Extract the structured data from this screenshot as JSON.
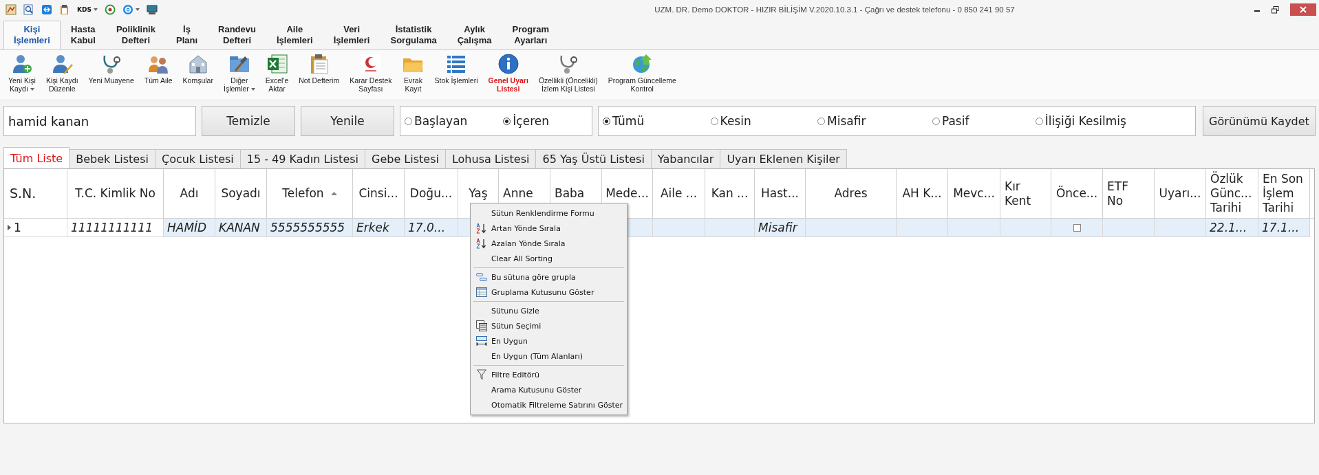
{
  "window": {
    "title": "UZM. DR. Demo DOKTOR - HIZIR BİLİŞİM V.2020.10.3.1 - Çağrı ve destek telefonu - 0 850 241 90 57"
  },
  "quick_access": [
    {
      "kind": "icon"
    },
    {
      "kind": "icon"
    },
    {
      "kind": "icon"
    },
    {
      "kind": "icon"
    },
    {
      "kind": "text",
      "label": "KDS",
      "dropdown": true
    },
    {
      "kind": "icon"
    },
    {
      "kind": "icon",
      "dropdown": true
    },
    {
      "kind": "icon"
    }
  ],
  "ribbon_tabs": [
    {
      "label": "Kişi\nİşlemleri",
      "selected": true
    },
    {
      "label": "Hasta\nKabul",
      "selected": false
    },
    {
      "label": "Poliklinik\nDefteri",
      "selected": false
    },
    {
      "label": "İş\nPlanı",
      "selected": false
    },
    {
      "label": "Randevu\nDefteri",
      "selected": false
    },
    {
      "label": "Aile\nİşlemleri",
      "selected": false
    },
    {
      "label": "Veri\nİşlemleri",
      "selected": false
    },
    {
      "label": "İstatistik\nSorgulama",
      "selected": false
    },
    {
      "label": "Aylık\nÇalışma",
      "selected": false
    },
    {
      "label": "Program\nAyarları",
      "selected": false
    }
  ],
  "toolbar": [
    {
      "label": "Yeni Kişi\nKaydı",
      "dropdown": true,
      "highlighted": false
    },
    {
      "label": "Kişi Kaydı\nDüzenle",
      "dropdown": false,
      "highlighted": false
    },
    {
      "label": "Yeni Muayene",
      "dropdown": false,
      "highlighted": false
    },
    {
      "label": "Tüm Aile",
      "dropdown": false,
      "highlighted": false
    },
    {
      "label": "Komşular",
      "dropdown": false,
      "highlighted": false
    },
    {
      "label": "Diğer\nİşlemler",
      "dropdown": true,
      "highlighted": false
    },
    {
      "label": "Excel'e\nAktar",
      "dropdown": false,
      "highlighted": false
    },
    {
      "label": "Not Defterim",
      "dropdown": false,
      "highlighted": false
    },
    {
      "label": "Karar Destek\nSayfası",
      "dropdown": false,
      "highlighted": false
    },
    {
      "label": "Evrak\nKayıt",
      "dropdown": false,
      "highlighted": false
    },
    {
      "label": "Stok İşlemleri",
      "dropdown": false,
      "highlighted": false
    },
    {
      "label": "Genel Uyarı\nListesi",
      "dropdown": false,
      "highlighted": true
    },
    {
      "label": "Özellikli (Öncelikli)\nİzlem Kişi Listesi",
      "dropdown": false,
      "highlighted": false
    },
    {
      "label": "Program Güncelleme\nKontrol",
      "dropdown": false,
      "highlighted": false
    }
  ],
  "search": {
    "value": "hamid kanan"
  },
  "buttons": [
    "Temizle",
    "Yenile"
  ],
  "match_options": [
    {
      "label": "Başlayan",
      "selected": false
    },
    {
      "label": "İçeren",
      "selected": true
    }
  ],
  "status_options": [
    {
      "label": "Tümü",
      "selected": true
    },
    {
      "label": "Kesin",
      "selected": false
    },
    {
      "label": "Misafir",
      "selected": false
    },
    {
      "label": "Pasif",
      "selected": false
    },
    {
      "label": "İlişiği Kesilmiş",
      "selected": false
    }
  ],
  "save_view_button": "Görünümü Kaydet",
  "list_tabs": [
    {
      "label": "Tüm Liste",
      "selected": true
    },
    {
      "label": "Bebek Listesi",
      "selected": false
    },
    {
      "label": "Çocuk Listesi",
      "selected": false
    },
    {
      "label": "15 - 49 Kadın Listesi",
      "selected": false
    },
    {
      "label": "Gebe Listesi",
      "selected": false
    },
    {
      "label": "Lohusa Listesi",
      "selected": false
    },
    {
      "label": "65 Yaş Üstü Listesi",
      "selected": false
    },
    {
      "label": "Yabancılar",
      "selected": false
    },
    {
      "label": "Uyarı Eklenen Kişiler",
      "selected": false
    }
  ],
  "table": {
    "columns": [
      {
        "label": "S.N.",
        "sorted": false
      },
      {
        "label": "T.C. Kimlik No",
        "sorted": false
      },
      {
        "label": "Adı",
        "sorted": false
      },
      {
        "label": "Soyadı",
        "sorted": false
      },
      {
        "label": "Telefon",
        "sorted": true
      },
      {
        "label": "Cinsi...",
        "sorted": false
      },
      {
        "label": "Doğu...",
        "sorted": false
      },
      {
        "label": "Yaş",
        "sorted": false
      },
      {
        "label": "Anne",
        "sorted": false
      },
      {
        "label": "Baba",
        "sorted": false
      },
      {
        "label": "Mede...",
        "sorted": false
      },
      {
        "label": "Aile ...",
        "sorted": false
      },
      {
        "label": "Kan ...",
        "sorted": false
      },
      {
        "label": "Hast...",
        "sorted": false
      },
      {
        "label": "Adres",
        "sorted": false
      },
      {
        "label": "AH K...",
        "sorted": false
      },
      {
        "label": "Mevc...",
        "sorted": false
      },
      {
        "label": "Kır\nKent",
        "sorted": false
      },
      {
        "label": "Önce...",
        "sorted": false
      },
      {
        "label": "ETF\nNo",
        "sorted": false
      },
      {
        "label": "Uyarı...",
        "sorted": false
      },
      {
        "label": "Özlük\nGünc...\nTarihi",
        "sorted": false
      },
      {
        "label": "En Son\nİşlem\nTarihi",
        "sorted": false
      }
    ],
    "rows": [
      {
        "selected": true,
        "cells": [
          {
            "kind": "text",
            "text": "1"
          },
          {
            "kind": "text",
            "text": "11111111111"
          },
          {
            "kind": "text",
            "text": "HAMİD"
          },
          {
            "kind": "text",
            "text": "KANAN"
          },
          {
            "kind": "text",
            "text": "5555555555"
          },
          {
            "kind": "text",
            "text": "Erkek"
          },
          {
            "kind": "text",
            "text": "17.0..."
          },
          {
            "kind": "empty"
          },
          {
            "kind": "empty"
          },
          {
            "kind": "empty"
          },
          {
            "kind": "empty"
          },
          {
            "kind": "empty"
          },
          {
            "kind": "empty"
          },
          {
            "kind": "text",
            "text": "Misafir"
          },
          {
            "kind": "empty"
          },
          {
            "kind": "empty"
          },
          {
            "kind": "empty"
          },
          {
            "kind": "empty"
          },
          {
            "kind": "checkbox",
            "checked": false
          },
          {
            "kind": "empty"
          },
          {
            "kind": "empty"
          },
          {
            "kind": "text",
            "text": "22.1..."
          },
          {
            "kind": "text",
            "text": "17.1..."
          }
        ]
      }
    ]
  },
  "context_menu": {
    "groups": [
      [
        {
          "label": "Sütun Renklendirme Formu"
        },
        {
          "label": "Artan Yönde Sırala"
        },
        {
          "label": "Azalan Yönde Sırala"
        },
        {
          "label": "Clear All Sorting"
        }
      ],
      [
        {
          "label": "Bu sütuna göre grupla"
        },
        {
          "label": "Gruplama Kutusunu Göster"
        }
      ],
      [
        {
          "label": "Sütunu Gizle"
        },
        {
          "label": "Sütun Seçimi"
        },
        {
          "label": "En Uygun"
        },
        {
          "label": "En Uygun (Tüm Alanları)"
        }
      ],
      [
        {
          "label": "Filtre Editörü"
        },
        {
          "label": "Arama Kutusunu Göster"
        },
        {
          "label": "Otomatik Filtreleme Satırını Göster"
        }
      ]
    ]
  }
}
